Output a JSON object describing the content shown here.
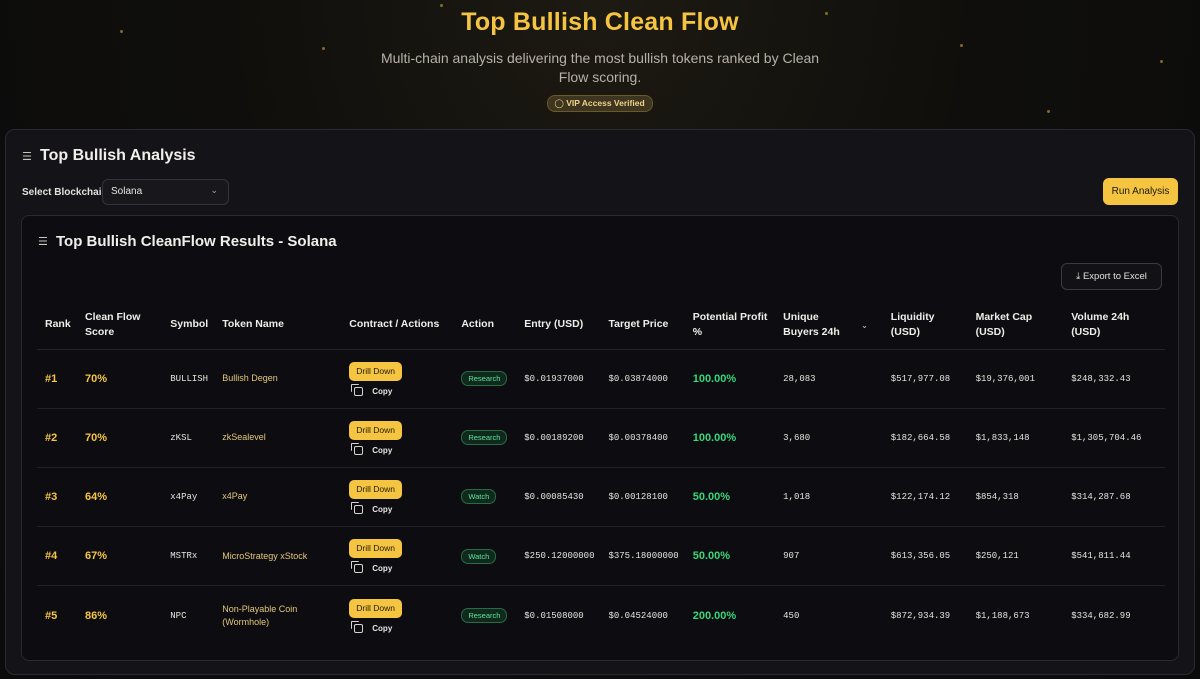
{
  "header": {
    "title": "Top Bullish Clean Flow",
    "subtitle": "Multi-chain analysis delivering the most bullish tokens ranked by Clean Flow scoring.",
    "vip_badge": "VIP Access Verified"
  },
  "analysis": {
    "title": "Top Bullish Analysis",
    "chain_label": "Select Blockchain:",
    "chain_value": "Solana",
    "run_button": "Run Analysis"
  },
  "results": {
    "title": "Top Bullish CleanFlow Results - Solana",
    "export_button": "Export to Excel",
    "columns": [
      "Rank",
      "Clean Flow Score",
      "Symbol",
      "Token Name",
      "Contract / Actions",
      "Action",
      "Entry (USD)",
      "Target Price",
      "Potential Profit %",
      "Unique Buyers 24h",
      "Liquidity (USD)",
      "Market Cap (USD)",
      "Volume 24h (USD)"
    ],
    "drill_label": "Drill Down",
    "copy_label": "Copy",
    "rows": [
      {
        "rank": "#1",
        "score": "70%",
        "symbol": "BULLISH",
        "name": "Bullish Degen",
        "action": "Research",
        "entry": "$0.01937000",
        "target": "$0.03874000",
        "profit": "100.00%",
        "buyers": "28,083",
        "liquidity": "$517,977.08",
        "mcap": "$19,376,001",
        "volume": "$248,332.43"
      },
      {
        "rank": "#2",
        "score": "70%",
        "symbol": "zKSL",
        "name": "zkSealevel",
        "action": "Research",
        "entry": "$0.00189200",
        "target": "$0.00378400",
        "profit": "100.00%",
        "buyers": "3,680",
        "liquidity": "$182,664.58",
        "mcap": "$1,833,148",
        "volume": "$1,305,704.46"
      },
      {
        "rank": "#3",
        "score": "64%",
        "symbol": "x4Pay",
        "name": "x4Pay",
        "action": "Watch",
        "entry": "$0.00085430",
        "target": "$0.00128100",
        "profit": "50.00%",
        "buyers": "1,018",
        "liquidity": "$122,174.12",
        "mcap": "$854,318",
        "volume": "$314,287.68"
      },
      {
        "rank": "#4",
        "score": "67%",
        "symbol": "MSTRx",
        "name": "MicroStrategy xStock",
        "action": "Watch",
        "entry": "$250.12000000",
        "target": "$375.18000000",
        "profit": "50.00%",
        "buyers": "907",
        "liquidity": "$613,356.05",
        "mcap": "$250,121",
        "volume": "$541,811.44"
      },
      {
        "rank": "#5",
        "score": "86%",
        "symbol": "NPC",
        "name": "Non-Playable Coin (Wormhole)",
        "action": "Research",
        "entry": "$0.01508000",
        "target": "$0.04524000",
        "profit": "200.00%",
        "buyers": "450",
        "liquidity": "$872,934.39",
        "mcap": "$1,188,673",
        "volume": "$334,682.99"
      }
    ]
  }
}
